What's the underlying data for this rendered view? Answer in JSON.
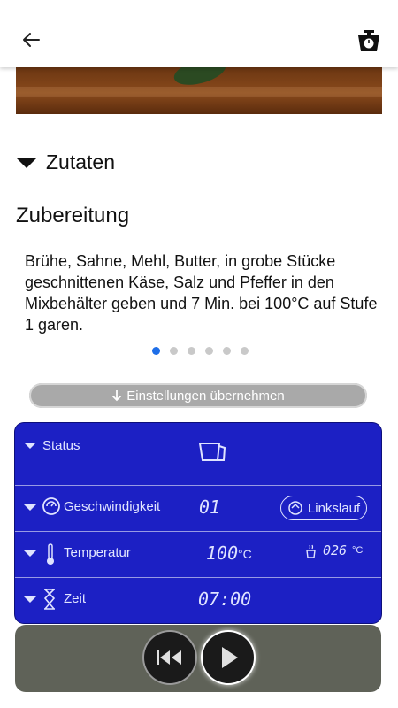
{
  "header": {
    "back_icon": "arrow-left-icon",
    "scale_icon": "kitchen-scale-icon"
  },
  "ingredients_section": {
    "label": "Zutaten"
  },
  "preparation": {
    "heading": "Zubereitung",
    "step_text": "Brühe, Sahne, Mehl, Butter, in grobe Stücke geschnittenen Käse, Salz und Pfeffer in den Mixbehälter geben und 7 Min. bei 100°C auf Stufe 1 garen.",
    "pagination": {
      "total": 6,
      "active": 1
    }
  },
  "apply_settings": {
    "label": "Einstellungen übernehmen",
    "icon": "arrow-down-icon"
  },
  "panel": {
    "colors": {
      "background": "#1c20c4",
      "text": "#dfe3ff"
    },
    "status": {
      "label": "Status",
      "icon": "bowl-icon"
    },
    "speed": {
      "label": "Geschwindigkeit",
      "value": "01",
      "reverse_label": "Linkslauf",
      "icon": "speed-icon"
    },
    "temperature": {
      "label": "Temperatur",
      "value": "100",
      "unit": "°C",
      "bowl_value": "026",
      "bowl_unit": "°C",
      "icon": "thermometer-icon"
    },
    "time": {
      "label": "Zeit",
      "value": "07:00",
      "icon": "hourglass-icon"
    }
  },
  "controls": {
    "rewind_icon": "skip-back-icon",
    "play_icon": "play-icon"
  }
}
